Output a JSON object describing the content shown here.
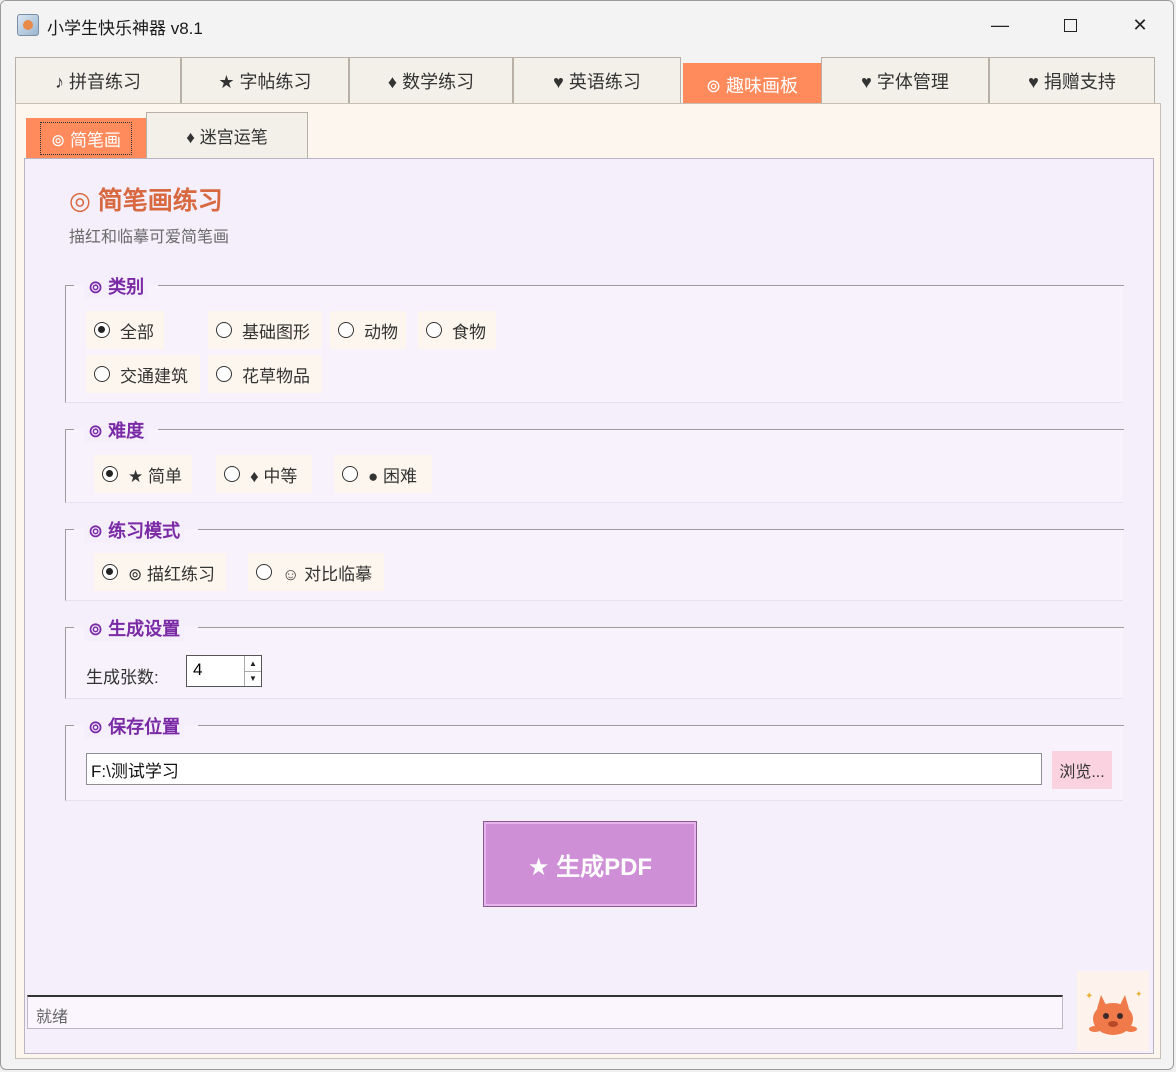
{
  "window": {
    "title": "小学生快乐神器 v8.1",
    "minimize": "—",
    "close": "✕"
  },
  "main_tabs": [
    {
      "label": "♪ 拼音练习",
      "active": false
    },
    {
      "label": "★ 字帖练习",
      "active": false
    },
    {
      "label": "♦ 数学练习",
      "active": false
    },
    {
      "label": "♥ 英语练习",
      "active": false
    },
    {
      "label": "⊚ 趣味画板",
      "active": true
    },
    {
      "label": "♥ 字体管理",
      "active": false
    },
    {
      "label": "♥ 捐赠支持",
      "active": false
    }
  ],
  "sub_tabs": [
    {
      "label": "⊚ 简笔画",
      "active": true
    },
    {
      "label": "♦ 迷宫运笔",
      "active": false
    }
  ],
  "page": {
    "title": "◎ 简笔画练习",
    "subtitle": "描红和临摹可爱简笔画"
  },
  "category": {
    "label": "⊚ 类别",
    "options": [
      {
        "label": "全部",
        "selected": true
      },
      {
        "label": "基础图形",
        "selected": false
      },
      {
        "label": "动物",
        "selected": false
      },
      {
        "label": "食物",
        "selected": false
      },
      {
        "label": "交通建筑",
        "selected": false
      },
      {
        "label": "花草物品",
        "selected": false
      }
    ]
  },
  "difficulty": {
    "label": "⊚ 难度",
    "options": [
      {
        "label": "★ 简单",
        "selected": true
      },
      {
        "label": "♦ 中等",
        "selected": false
      },
      {
        "label": "● 困难",
        "selected": false
      }
    ]
  },
  "mode": {
    "label": "⊚ 练习模式",
    "options": [
      {
        "label": "⊚ 描红练习",
        "selected": true
      },
      {
        "label": "☺ 对比临摹",
        "selected": false
      }
    ]
  },
  "settings": {
    "label": "⊚ 生成设置",
    "count_label": "生成张数:",
    "count_value": "4"
  },
  "save": {
    "label": "⊚ 保存位置",
    "path": "F:\\测试学习",
    "browse_label": "浏览..."
  },
  "generate_label": "★ 生成PDF",
  "status": "就绪",
  "colors": {
    "accent": "#ff8a5c",
    "group_title": "#7a2aa5",
    "section_title": "#d8683f",
    "generate": "#cf8fd6",
    "panel_bg": "#f5eefb"
  }
}
